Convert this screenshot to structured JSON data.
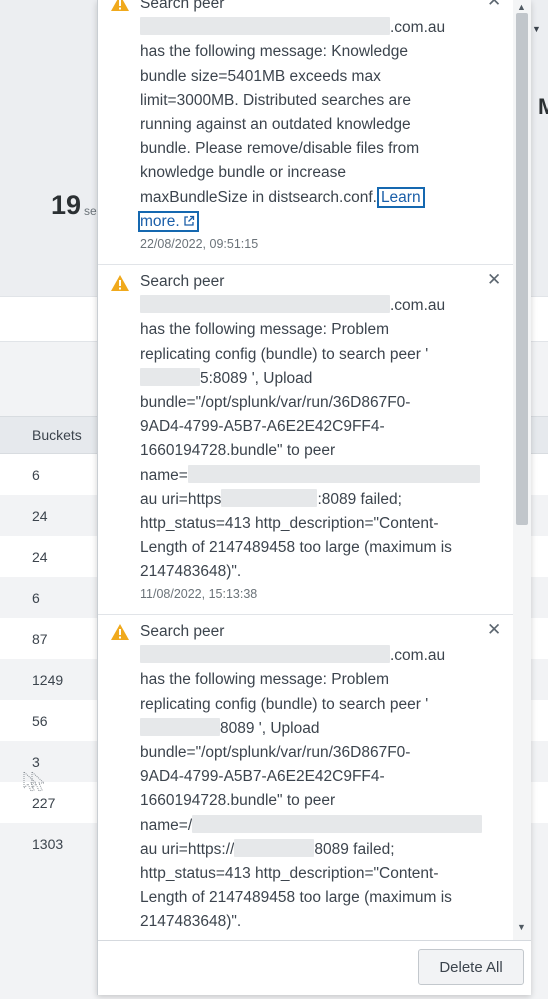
{
  "background": {
    "summary_number": "19",
    "summary_unit_fragment": "se",
    "right_edge_char": "M",
    "table": {
      "column_header": "Buckets",
      "rows": [
        "6",
        "24",
        "24",
        "6",
        "87",
        "1249",
        "56",
        "3",
        "227",
        "1303"
      ]
    }
  },
  "notifications": [
    {
      "title": "Search peer",
      "host_suffix": ".com.au",
      "lines": [
        "has the following message: Knowledge",
        "bundle size=5401MB exceeds max",
        "limit=3000MB. Distributed searches are",
        "running against an outdated knowledge",
        "bundle. Please remove/disable files from",
        "knowledge bundle or increase",
        "maxBundleSize in distsearch.conf."
      ],
      "link_part1": "Learn",
      "link_part2": "more.",
      "timestamp": "22/08/2022, 09:51:15"
    },
    {
      "title": "Search peer",
      "host_suffix": ".com.au",
      "lines": [
        "has the following message: Problem",
        "replicating config (bundle) to search peer '"
      ],
      "peer_port": "5:8089 ', Upload",
      "lines2": [
        "bundle=\"/opt/splunk/var/run/36D867F0-",
        "9AD4-4799-A5B7-A6E2E42C9FF4-",
        "1660194728.bundle\" to peer",
        "name="
      ],
      "uri_prefix": "au uri=https",
      "uri_suffix": ":8089 failed;",
      "lines3": [
        "http_status=413 http_description=\"Content-",
        "Length of 2147489458 too large (maximum is",
        "2147483648)\"."
      ],
      "timestamp": "11/08/2022, 15:13:38"
    },
    {
      "title": "Search peer",
      "host_suffix": ".com.au",
      "lines": [
        "has the following message: Problem",
        "replicating config (bundle) to search peer '"
      ],
      "peer_port": "8089 ', Upload",
      "lines2": [
        "bundle=\"/opt/splunk/var/run/36D867F0-",
        "9AD4-4799-A5B7-A6E2E42C9FF4-",
        "1660194728.bundle\" to peer",
        "name=/"
      ],
      "uri_prefix": "au uri=https://",
      "uri_suffix": "8089 failed;",
      "lines3": [
        "http_status=413 http_description=\"Content-",
        "Length of 2147489458 too large (maximum is",
        "2147483648)\"."
      ]
    }
  ],
  "footer": {
    "delete_all_label": "Delete All"
  },
  "icons": {
    "warning": "warning-triangle-icon",
    "close": "close-icon",
    "external": "external-link-icon"
  },
  "colors": {
    "warning": "#f0a91c",
    "link": "#1a5ea8"
  }
}
